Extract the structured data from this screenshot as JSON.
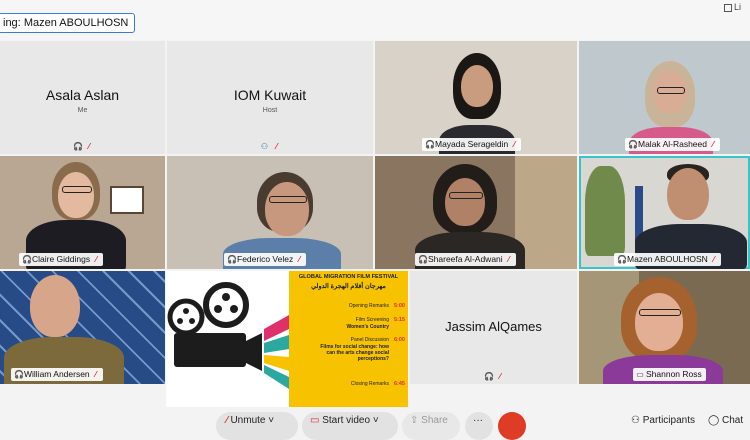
{
  "app": {
    "speaking_prefix": "ing:",
    "speaking_name": "Mazen ABOULHOSN",
    "view_label": "Li"
  },
  "participants": {
    "asala": {
      "name": "Asala Aslan",
      "role": "Me"
    },
    "iom": {
      "name": "IOM Kuwait",
      "role": "Host"
    },
    "mayada": {
      "name": "Mayada Serageldin"
    },
    "malak": {
      "name": "Malak Al-Rasheed"
    },
    "claire": {
      "name": "Claire Giddings"
    },
    "federico": {
      "name": "Federico Velez"
    },
    "shareefa": {
      "name": "Shareefa Al-Adwani"
    },
    "mazen": {
      "name": "Mazen ABOULHOSN"
    },
    "william": {
      "name": "William Andersen"
    },
    "jassim": {
      "name": "Jassim AlQames"
    },
    "shannon": {
      "name": "Shannon Ross"
    }
  },
  "poster": {
    "title": "GLOBAL MIGRATION FILM FESTIVAL",
    "arabic_title": "مهرجان أفلام الهجرة الدولي",
    "rows": [
      {
        "label": "Opening Remarks",
        "time": "5:00"
      },
      {
        "label": "Film Screening",
        "sub": "Women's Country",
        "time": "5:15"
      },
      {
        "label": "Panel Discussion",
        "sub": "Films for social change: how can the arts change social perceptions?",
        "time": "6:00"
      },
      {
        "label": "Closing Remarks",
        "time": "6:45"
      }
    ]
  },
  "toolbar": {
    "unmute": "Unmute",
    "start_video": "Start video",
    "share": "Share",
    "more": "···",
    "participants": "Participants",
    "chat": "Chat"
  },
  "colors": {
    "active_border": "#38c4c9",
    "end_call": "#e03b24",
    "poster_yellow": "#f7c200",
    "muted_red": "#dd2233"
  }
}
